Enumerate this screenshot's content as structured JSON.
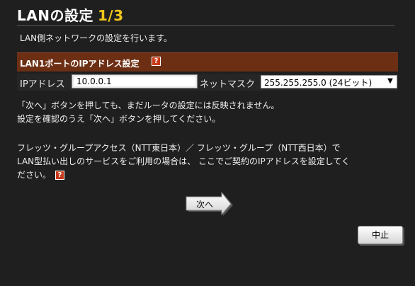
{
  "header": {
    "title": "LANの設定",
    "step": "1/3",
    "subtitle": "LAN側ネットワークの設定を行います。"
  },
  "section": {
    "label": "LAN1ポートのIPアドレス設定",
    "help_glyph": "?"
  },
  "form": {
    "ip_label": "IPアドレス",
    "ip_value": "10.0.0.1",
    "mask_label": "ネットマスク",
    "mask_value": "255.255.255.0 (24ビット)"
  },
  "notice": {
    "line1": "「次へ」ボタンを押しても、まだルータの設定には反映されません。",
    "line2": "設定を確認のうえ「次へ」ボタンを押してください。"
  },
  "notice2": {
    "line1": "フレッツ・グループアクセス（NTT東日本）／ フレッツ・グループ（NTT西日本）で",
    "line2": "LAN型払い出しのサービスをご利用の場合は、 ここでご契約のIPアドレスを設定してく",
    "line3": "ださい。",
    "help_glyph": "?"
  },
  "buttons": {
    "next_label": "次へ",
    "cancel_label": "中止"
  },
  "colors": {
    "accent_step": "#f0c61d",
    "section_bar": "#6d2f14",
    "help_icon": "#c8391a"
  }
}
